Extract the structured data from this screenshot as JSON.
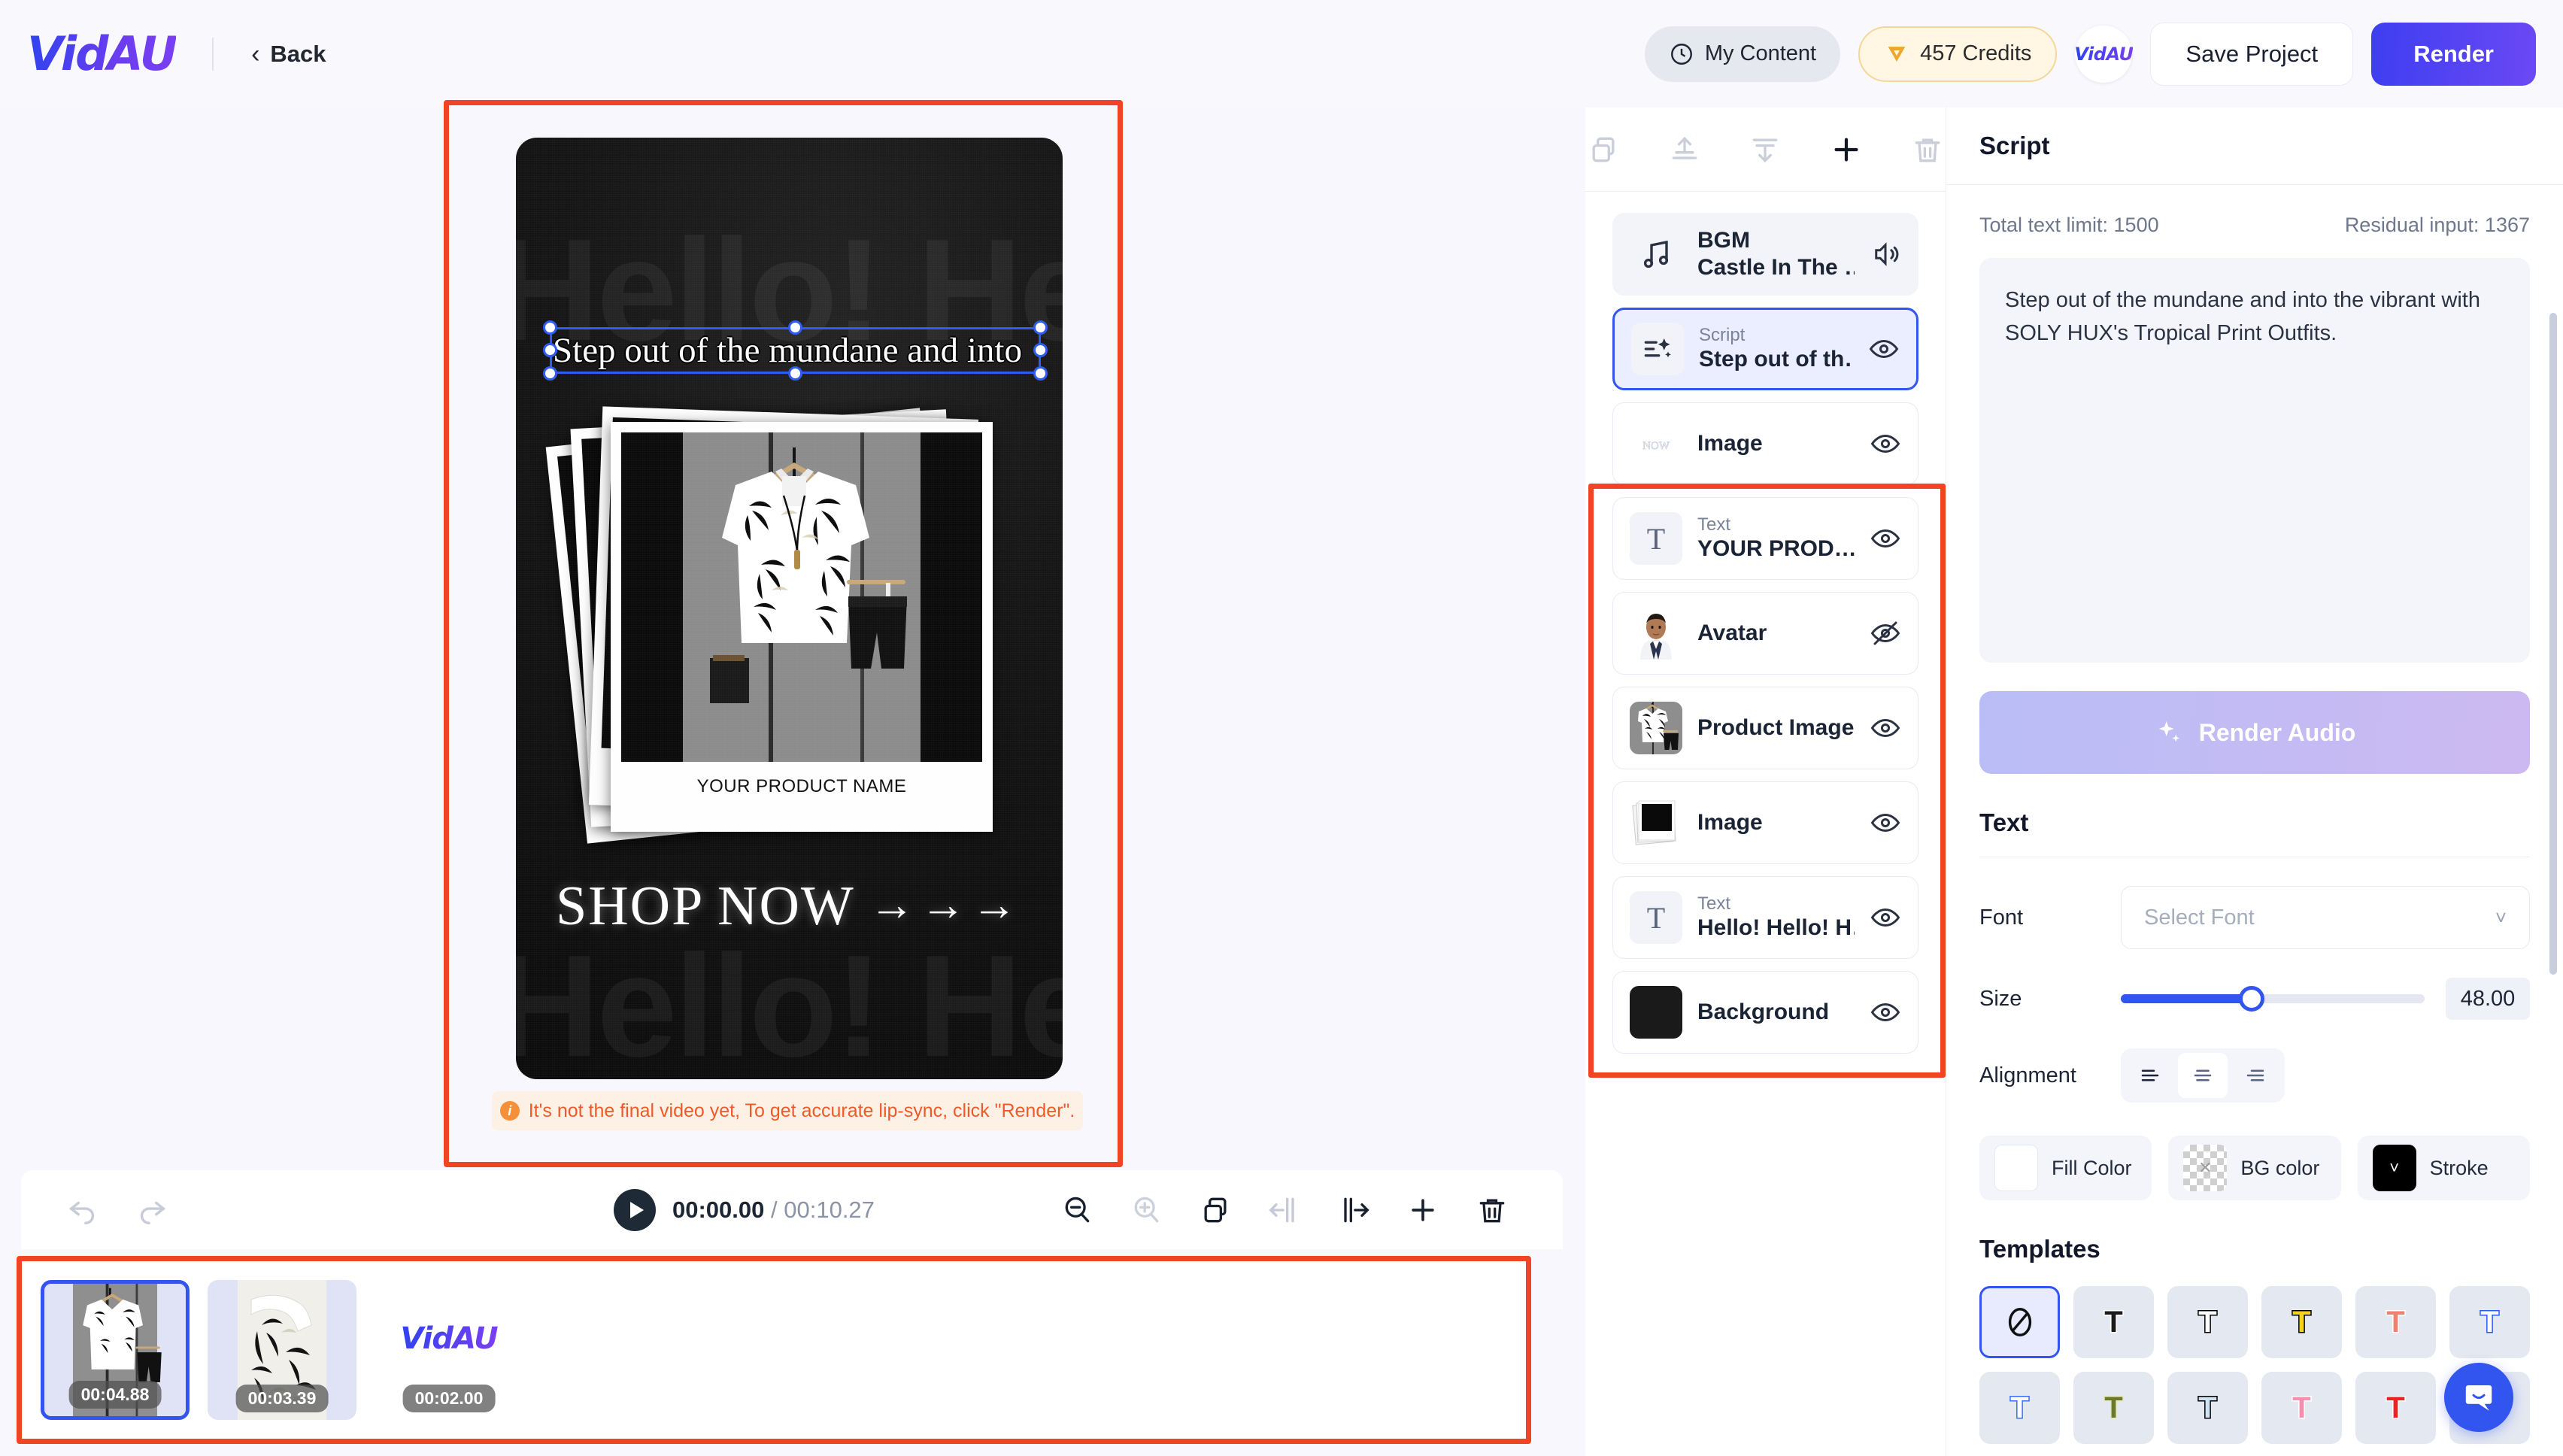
{
  "app": {
    "logo": "VidAU"
  },
  "header": {
    "back_label": "Back",
    "my_content_label": "My Content",
    "credits_label": "457 Credits",
    "vidau_badge": "VidAU",
    "save_label": "Save Project",
    "render_label": "Render",
    "accent_color": "#3d3ff0",
    "credits_bg": "#fff6e4"
  },
  "canvas": {
    "selected_caption": "Step out of the mundane and into",
    "bg_text": "Hello! Hello! H",
    "bg_text_2": "Hello! Hello! H",
    "product_name": "YOUR PRODUCT NAME",
    "shop_now": "SHOP NOW",
    "shop_arrows": "→→→",
    "lipsync_note": "It's not the final video yet, To get accurate lip-sync, click \"Render\".",
    "note_color": "#f05a28"
  },
  "timeline": {
    "current_time": "00:00.00",
    "total_time": "/ 00:10.27",
    "tools": [
      "undo-icon",
      "redo-icon",
      "zoom-out-icon",
      "zoom-in-icon",
      "duplicate-icon",
      "split-left-icon",
      "split-right-icon",
      "add-icon",
      "delete-icon"
    ],
    "clips": [
      {
        "duration": "00:04.88",
        "selected": true,
        "kind": "product-photo"
      },
      {
        "duration": "00:03.39",
        "selected": false,
        "kind": "shirt-closeup"
      },
      {
        "duration": "00:02.00",
        "selected": false,
        "kind": "vidau-outro",
        "label": "VidAU"
      }
    ]
  },
  "layers": {
    "toolbar_icons": [
      "duplicate-icon",
      "bring-to-front-icon",
      "send-to-back-icon",
      "add-icon",
      "delete-icon"
    ],
    "items": [
      {
        "kind": "",
        "name": "BGM",
        "subname": "Castle In The …",
        "icon": "music-note-icon",
        "state": "bgm",
        "visibility": "volume-on-icon"
      },
      {
        "kind": "Script",
        "name": "Step out of th…",
        "icon": "script-sparkle-icon",
        "state": "active",
        "visibility": "eye-icon"
      },
      {
        "kind": "",
        "name": "Image",
        "icon": "shop-now-thumb",
        "state": "",
        "visibility": "eye-icon"
      },
      {
        "kind": "Text",
        "name": "YOUR PROD…",
        "icon": "text-t-icon",
        "state": "",
        "visibility": "eye-icon"
      },
      {
        "kind": "",
        "name": "Avatar",
        "icon": "avatar-thumb",
        "state": "",
        "visibility": "eye-off-icon"
      },
      {
        "kind": "",
        "name": "Product Image",
        "icon": "product-thumb",
        "state": "",
        "visibility": "eye-icon"
      },
      {
        "kind": "",
        "name": "Image",
        "icon": "polaroid-thumb",
        "state": "",
        "visibility": "eye-icon"
      },
      {
        "kind": "Text",
        "name": "Hello! Hello! H…",
        "icon": "text-t-icon",
        "state": "",
        "visibility": "eye-icon"
      },
      {
        "kind": "",
        "name": "Background",
        "icon": "dark-bg-thumb",
        "state": "",
        "visibility": "eye-icon"
      }
    ]
  },
  "props": {
    "title": "Script",
    "total_text_limit": "Total text limit: 1500",
    "residual_input": "Residual input: 1367",
    "script_text": "Step out of the mundane and into the vibrant with SOLY HUX's Tropical Print Outfits.",
    "render_audio_label": "Render Audio",
    "text_section_title": "Text",
    "font_label": "Font",
    "font_placeholder": "Select Font",
    "size_label": "Size",
    "size_value": "48.00",
    "alignment_label": "Alignment",
    "alignment_selected": "center",
    "fill_color_label": "Fill Color",
    "bg_color_label": "BG color",
    "stroke_label": "Stroke",
    "fill_color_value": "#ffffff",
    "bg_color_value": "transparent",
    "stroke_color_value": "#000000",
    "templates_title": "Templates",
    "templates": [
      {
        "type": "none",
        "fill": "#000000",
        "stroke": "none"
      },
      {
        "type": "t",
        "fill": "#1a1a1a",
        "stroke": "#ffffff"
      },
      {
        "type": "t",
        "fill": "#ffffff",
        "stroke": "#000000"
      },
      {
        "type": "t",
        "fill": "#f5d020",
        "stroke": "#000000"
      },
      {
        "type": "t",
        "fill": "#f08070",
        "stroke": "#ffffff"
      },
      {
        "type": "t",
        "fill": "#ffffff",
        "stroke": "#2a5bef"
      },
      {
        "type": "t",
        "fill": "#ffffff",
        "stroke": "#3b6ff0"
      },
      {
        "type": "t",
        "fill": "#6a7a2a",
        "stroke": "#e8e8c0"
      },
      {
        "type": "t",
        "fill": "#cfe3f5",
        "stroke": "#000000"
      },
      {
        "type": "t",
        "fill": "#f58fb0",
        "stroke": "#ffffff"
      },
      {
        "type": "t",
        "fill": "#ee2222",
        "stroke": "#ffffff"
      },
      {
        "type": "t",
        "fill": "#8a3b2a",
        "stroke": "#ffffff"
      }
    ]
  },
  "chat": {
    "icon": "chat-bubble-icon"
  }
}
